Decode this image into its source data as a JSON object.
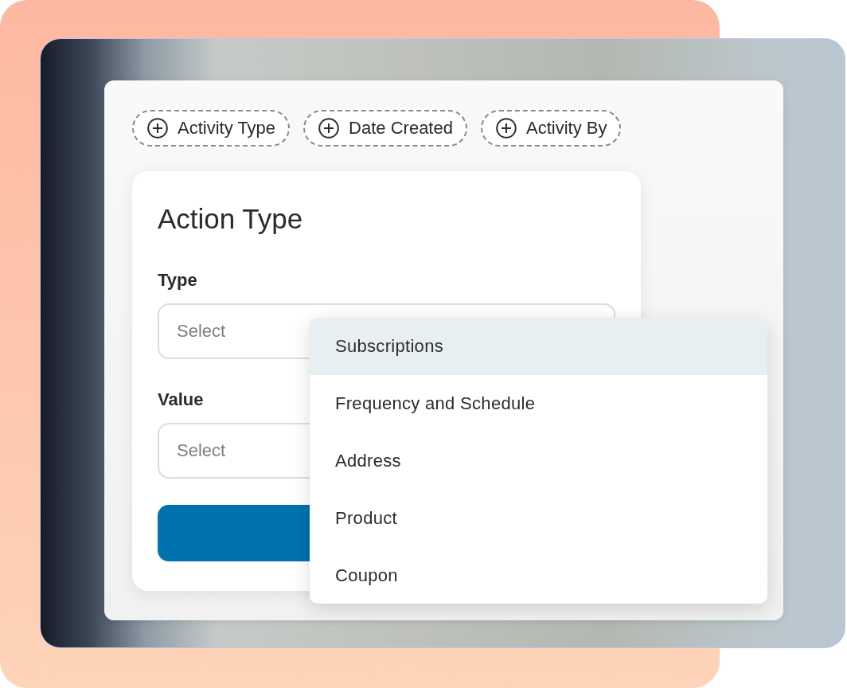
{
  "filter_chips": [
    {
      "label": "Activity Type"
    },
    {
      "label": "Date Created"
    },
    {
      "label": "Activity By"
    }
  ],
  "form": {
    "title": "Action Type",
    "fields": [
      {
        "label": "Type",
        "placeholder": "Select"
      },
      {
        "label": "Value",
        "placeholder": "Select"
      }
    ]
  },
  "dropdown": {
    "options": [
      {
        "label": "Subscriptions",
        "selected": true
      },
      {
        "label": "Frequency and Schedule",
        "selected": false
      },
      {
        "label": "Address",
        "selected": false
      },
      {
        "label": "Product",
        "selected": false
      },
      {
        "label": "Coupon",
        "selected": false
      }
    ]
  }
}
